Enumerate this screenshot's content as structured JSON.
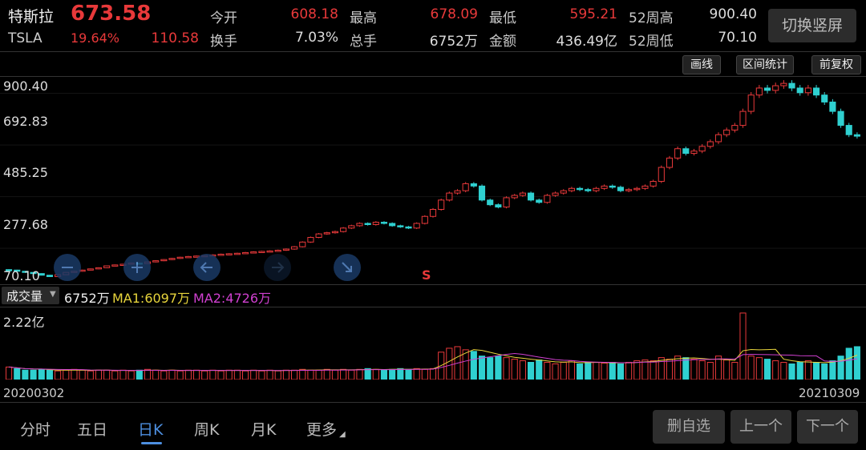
{
  "header": {
    "name": "特斯拉",
    "ticker": "TSLA",
    "price": "673.58",
    "change_pct": "19.64%",
    "change_abs": "110.58",
    "stats": [
      {
        "label": "今开",
        "value": "608.18"
      },
      {
        "label": "换手",
        "value": "7.03%"
      },
      {
        "label": "最高",
        "value": "678.09"
      },
      {
        "label": "总手",
        "value": "6752万"
      },
      {
        "label": "最低",
        "value": "595.21"
      },
      {
        "label": "金额",
        "value": "436.49亿"
      },
      {
        "label": "52周高",
        "value": "900.40"
      },
      {
        "label": "52周低",
        "value": "70.10"
      }
    ],
    "switch_button": "切换竖屏"
  },
  "tools": {
    "draw": "画线",
    "range_stats": "区间统计",
    "adjust": "前复权"
  },
  "price_axis": [
    "900.40",
    "692.83",
    "485.25",
    "277.68",
    "70.10"
  ],
  "marker": "S",
  "volume": {
    "selector": "成交量",
    "value": "6752万",
    "ma1": "MA1:6097万",
    "ma2": "MA2:4726万",
    "axis_max": "2.22亿"
  },
  "dates": {
    "start": "20200302",
    "end": "20210309"
  },
  "tabs": [
    "分时",
    "五日",
    "日K",
    "周K",
    "月K",
    "更多"
  ],
  "active_tab": "日K",
  "buttons": {
    "remove": "删自选",
    "prev": "上一个",
    "next": "下一个"
  },
  "colors": {
    "up": "#e8393a",
    "down": "#2fd0d0",
    "ma1": "#e8d53c",
    "ma2": "#d040d0",
    "active": "#4d8fe0"
  },
  "chart_data": {
    "type": "candlestick",
    "ylim": [
      70.1,
      900.4
    ],
    "close_series": [
      100,
      95,
      90,
      85,
      78,
      72,
      80,
      90,
      95,
      100,
      105,
      110,
      118,
      122,
      125,
      130,
      128,
      135,
      140,
      145,
      150,
      155,
      158,
      160,
      162,
      165,
      168,
      170,
      172,
      175,
      178,
      180,
      182,
      185,
      190,
      200,
      220,
      240,
      255,
      260,
      265,
      280,
      290,
      300,
      295,
      305,
      300,
      290,
      285,
      280,
      300,
      330,
      360,
      400,
      430,
      440,
      470,
      460,
      400,
      380,
      370,
      410,
      420,
      430,
      400,
      390,
      420,
      430,
      440,
      450,
      445,
      440,
      450,
      460,
      455,
      440,
      445,
      450,
      460,
      480,
      540,
      580,
      620,
      600,
      610,
      630,
      650,
      680,
      700,
      720,
      780,
      850,
      880,
      870,
      890,
      900,
      880,
      860,
      880,
      850,
      820,
      780,
      720,
      680,
      673.58
    ]
  },
  "volume_data": {
    "values": [
      16,
      14,
      12,
      12,
      13,
      12,
      11,
      12,
      13,
      12,
      11,
      12,
      12,
      11,
      12,
      11,
      12,
      13,
      12,
      11,
      12,
      11,
      12,
      12,
      11,
      12,
      11,
      12,
      12,
      11,
      12,
      11,
      12,
      11,
      12,
      12,
      13,
      12,
      12,
      13,
      12,
      13,
      12,
      13,
      14,
      13,
      12,
      13,
      14,
      13,
      14,
      13,
      14,
      35,
      40,
      42,
      38,
      36,
      30,
      28,
      30,
      28,
      26,
      24,
      22,
      25,
      22,
      20,
      22,
      24,
      20,
      22,
      22,
      21,
      22,
      20,
      22,
      24,
      25,
      24,
      28,
      26,
      30,
      28,
      26,
      24,
      22,
      30,
      25,
      22,
      85,
      30,
      28,
      26,
      24,
      22,
      20,
      22,
      24,
      22,
      20,
      24,
      30,
      40,
      42
    ]
  }
}
